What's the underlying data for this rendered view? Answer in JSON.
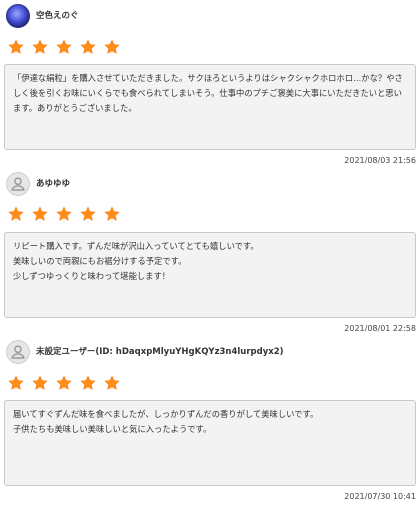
{
  "reviews": [
    {
      "user": "空色えのぐ",
      "avatar": "photo-avatar",
      "rating": 5,
      "text": "「伊達な絹粒」を購入させていただきました。サクほろというよりはシャクシャクホロホロ…かな？やさしく後を引くお味にいくらでも食べられてしまいそう。仕事中のプチご褒美に大事にいただきたいと思います。ありがとうございました。",
      "date": "2021/08/03 21:56"
    },
    {
      "user": "あゆゆゆ",
      "avatar": "default-user-icon",
      "rating": 5,
      "text": "リピート購入です。ずんだ味が沢山入っていてとても嬉しいです。\n美味しいので両親にもお裾分けする予定です。\n少しずつゆっくりと味わって堪能します！",
      "date": "2021/08/01 22:58"
    },
    {
      "user": "未設定ユーザー(ID: hDaqxpMlyuYHgKQYz3n4lurpdyx2)",
      "avatar": "default-user-icon",
      "rating": 5,
      "text": "届いてすぐずんだ味を食べましたが、しっかりずんだの香りがして美味しいです。\n子供たちも美味しい美味しいと気に入ったようです。",
      "date": "2021/07/30 10:41"
    }
  ],
  "colors": {
    "star": "#ff8c1a",
    "comment_bg": "#f3f3f3",
    "comment_border": "#c8c8c8"
  }
}
